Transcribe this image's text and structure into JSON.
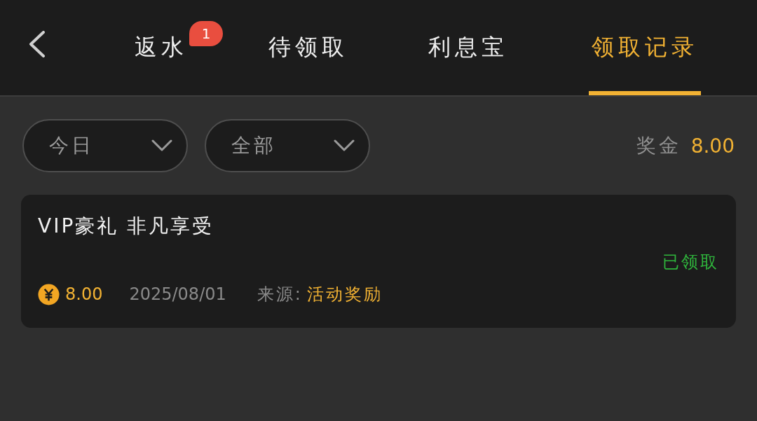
{
  "tabs": [
    {
      "label": "返水",
      "selected": false,
      "badge": "1"
    },
    {
      "label": "待领取",
      "selected": false
    },
    {
      "label": "利息宝",
      "selected": false
    },
    {
      "label": "领取记录",
      "selected": true
    }
  ],
  "filters": [
    {
      "value": "今日"
    },
    {
      "value": "全部"
    }
  ],
  "summary": {
    "label": "奖金",
    "amount": "8.00"
  },
  "records": [
    {
      "title": "VIP豪礼 非凡享受",
      "status": "已领取",
      "amount": "8.00",
      "date": "2025/08/01",
      "source_label": "来源:",
      "source": "活动奖励"
    }
  ]
}
